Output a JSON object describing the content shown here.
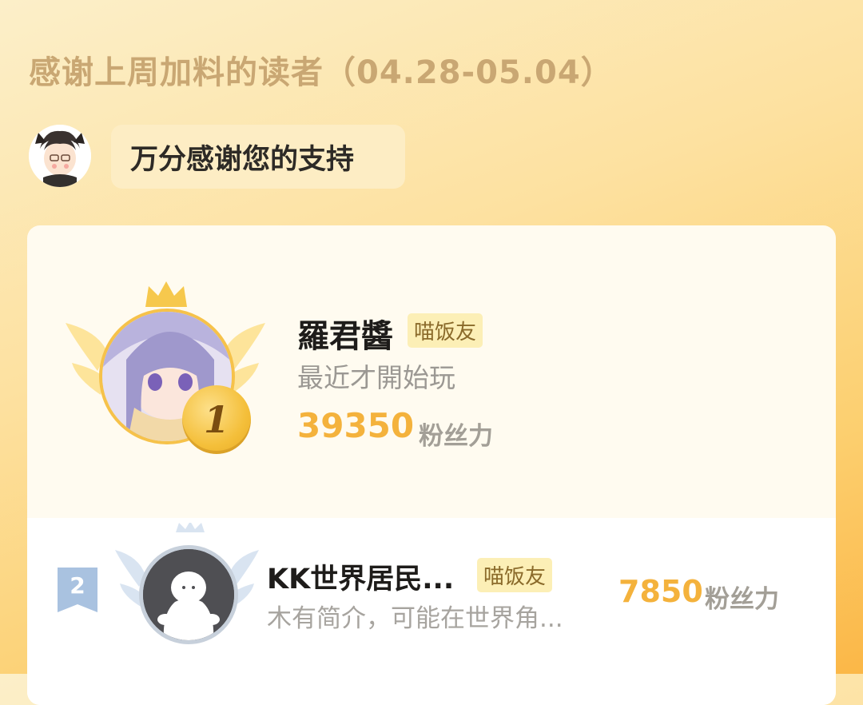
{
  "header": {
    "title": "感谢上周加料的读者（04.28-05.04）"
  },
  "thanks": {
    "message": "万分感谢您的支持",
    "mascot_icon": "mascot-avatar-icon"
  },
  "ranking": [
    {
      "rank": "1",
      "name": "羅君醬",
      "tag": "喵饭友",
      "bio": "最近才開始玩",
      "score": "39350",
      "unit": "粉丝力",
      "badge_color": "#f4bf3a"
    },
    {
      "rank": "2",
      "name": "KK世界居民...",
      "tag": "喵饭友",
      "bio": "木有简介，可能在世界角...",
      "score": "7850",
      "unit": "粉丝力",
      "badge_color": "#a9c2e0"
    }
  ],
  "colors": {
    "accent": "#f4b23c",
    "title": "#c9a773",
    "tag_bg": "#fcefb6"
  }
}
